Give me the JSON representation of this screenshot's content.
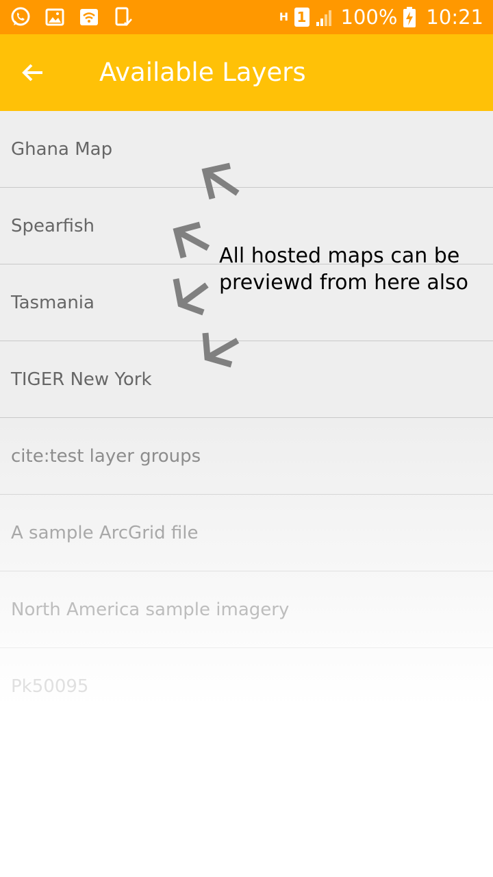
{
  "status_bar": {
    "battery": "100%",
    "time": "10:21",
    "sim": "1",
    "network": "H",
    "left_icons": [
      "whatsapp-icon",
      "gallery-icon",
      "wifi-hotspot-icon",
      "device-check-icon"
    ]
  },
  "app_bar": {
    "title": "Available Layers",
    "back_icon": "arrow-left-icon"
  },
  "layers": [
    "Ghana Map",
    "Spearfish",
    "Tasmania",
    "TIGER New York",
    "cite:test layer groups",
    "A sample ArcGrid file",
    "North America sample imagery",
    "Pk50095"
  ],
  "annotation": {
    "line1": "All hosted maps can be",
    "line2": "previewd from here also"
  },
  "colors": {
    "status_bar": "#ff9800",
    "app_bar": "#ffc107",
    "list_background": "#eeeeee",
    "annotation_arrow": "#808080"
  }
}
